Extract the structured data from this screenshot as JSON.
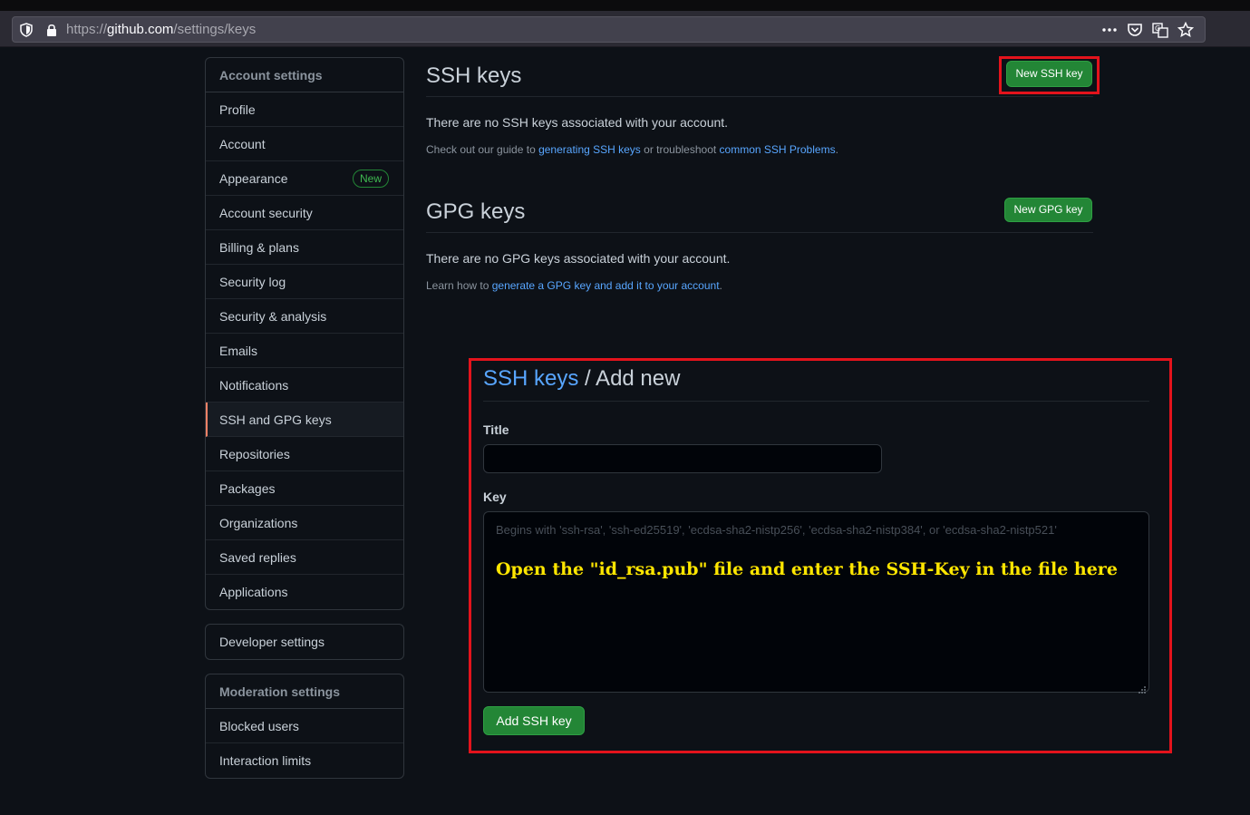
{
  "browser": {
    "url_prefix": "https://",
    "url_host": "github.com",
    "url_path": "/settings/keys",
    "icons": [
      "shield-icon",
      "lock-icon",
      "more-icon",
      "pocket-icon",
      "translate-icon",
      "bookmark-star-icon"
    ]
  },
  "sidebar": {
    "heading": "Account settings",
    "items": [
      {
        "label": "Profile"
      },
      {
        "label": "Account"
      },
      {
        "label": "Appearance",
        "badge": "New"
      },
      {
        "label": "Account security"
      },
      {
        "label": "Billing & plans"
      },
      {
        "label": "Security log"
      },
      {
        "label": "Security & analysis"
      },
      {
        "label": "Emails"
      },
      {
        "label": "Notifications"
      },
      {
        "label": "SSH and GPG keys",
        "selected": true
      },
      {
        "label": "Repositories"
      },
      {
        "label": "Packages"
      },
      {
        "label": "Organizations"
      },
      {
        "label": "Saved replies"
      },
      {
        "label": "Applications"
      }
    ],
    "developer": {
      "label": "Developer settings"
    },
    "moderation": {
      "heading": "Moderation settings",
      "items": [
        {
          "label": "Blocked users"
        },
        {
          "label": "Interaction limits"
        }
      ]
    }
  },
  "ssh": {
    "title": "SSH keys",
    "new_button": "New SSH key",
    "empty": "There are no SSH keys associated with your account.",
    "guide_prefix": "Check out our guide to ",
    "guide_link": "generating SSH keys",
    "guide_middle": " or troubleshoot ",
    "guide_link2": "common SSH Problems",
    "guide_suffix": "."
  },
  "gpg": {
    "title": "GPG keys",
    "new_button": "New GPG key",
    "empty": "There are no GPG keys associated with your account.",
    "learn_prefix": "Learn how to ",
    "learn_link": "generate a GPG key and add it to your account",
    "learn_suffix": "."
  },
  "form": {
    "breadcrumb_link": "SSH keys",
    "breadcrumb_rest": " / Add new",
    "title_label": "Title",
    "title_value": "",
    "key_label": "Key",
    "key_placeholder": "Begins with 'ssh-rsa', 'ssh-ed25519', 'ecdsa-sha2-nistp256', 'ecdsa-sha2-nistp384', or 'ecdsa-sha2-nistp521'",
    "annotation": "Open the \"id_rsa.pub\" file and enter the SSH-Key in the file here",
    "submit": "Add SSH key"
  },
  "colors": {
    "background": "#0d1117",
    "accent_green": "#238636",
    "link": "#58a6ff",
    "highlight_red": "#e3131c",
    "annotation_yellow": "#ffe600"
  }
}
